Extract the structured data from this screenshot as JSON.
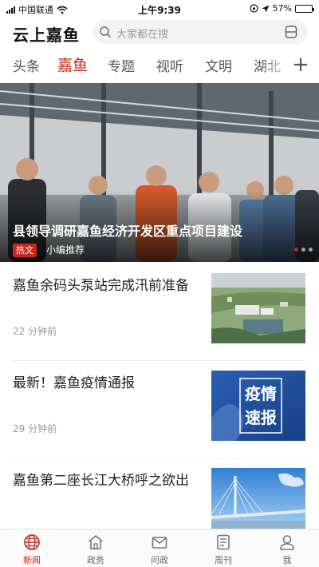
{
  "status_bar": {
    "carrier": "中国联通",
    "time": "上午9:39",
    "battery": "57%",
    "battery_level": 0.57
  },
  "header": {
    "title": "云上嘉鱼",
    "search_placeholder": "大家都在搜"
  },
  "tabs": [
    {
      "label": "头条",
      "active": false
    },
    {
      "label": "嘉鱼",
      "active": true
    },
    {
      "label": "专题",
      "active": false
    },
    {
      "label": "视听",
      "active": false
    },
    {
      "label": "文明",
      "active": false
    },
    {
      "label": "湖北",
      "active": false
    }
  ],
  "add_tab_label": "+",
  "hero": {
    "title": "县领导调研嘉鱼经济开发区重点项目建设",
    "tag": "热文",
    "source": "小编推荐"
  },
  "news": [
    {
      "title": "嘉鱼余码头泵站完成汛前准备",
      "time": "22 分钟前",
      "thumb": "aerial-pump-station"
    },
    {
      "title": "最新！嘉鱼疫情通报",
      "time": "29 分钟前",
      "thumb": "epidemic-bulletin",
      "thumb_text": [
        "疫情",
        "速报"
      ]
    },
    {
      "title": "嘉鱼第二座长江大桥呼之欲出",
      "time": "",
      "thumb": "cable-bridge"
    }
  ],
  "bottom_nav": [
    {
      "label": "新闻",
      "icon": "globe-icon",
      "active": true
    },
    {
      "label": "政务",
      "icon": "home-icon",
      "active": false
    },
    {
      "label": "问政",
      "icon": "mail-icon",
      "active": false
    },
    {
      "label": "周刊",
      "icon": "journal-icon",
      "active": false
    },
    {
      "label": "我",
      "icon": "person-icon",
      "active": false
    }
  ],
  "colors": {
    "accent": "#c8291f",
    "text": "#222222",
    "muted": "#999999"
  }
}
